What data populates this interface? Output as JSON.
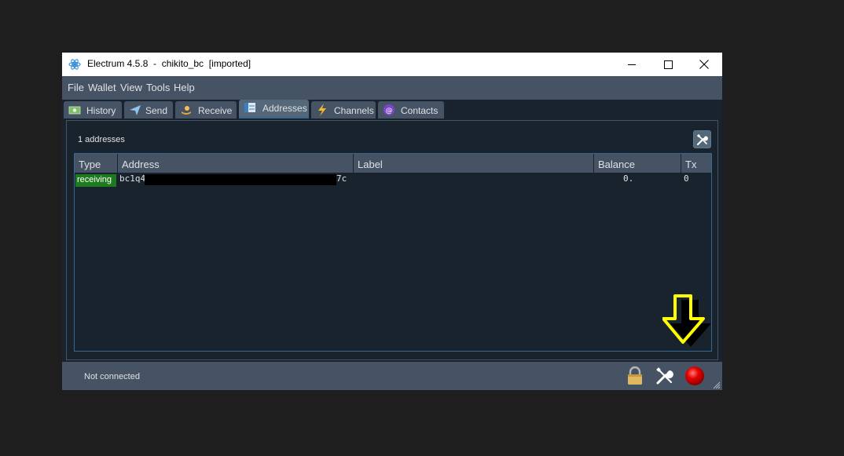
{
  "window": {
    "title": "Electrum 4.5.8  -  chikito_bc  [imported]"
  },
  "menu": [
    "File",
    "Wallet",
    "View",
    "Tools",
    "Help"
  ],
  "tabs": [
    {
      "label": "History",
      "icon": "history-icon"
    },
    {
      "label": "Send",
      "icon": "send-icon"
    },
    {
      "label": "Receive",
      "icon": "receive-icon"
    },
    {
      "label": "Addresses",
      "icon": "addresses-icon",
      "active": true
    },
    {
      "label": "Channels",
      "icon": "lightning-icon"
    },
    {
      "label": "Contacts",
      "icon": "contacts-icon"
    }
  ],
  "addresses": {
    "count_label": "1 addresses",
    "columns": [
      "Type",
      "Address",
      "Label",
      "Balance",
      "Tx"
    ],
    "rows": [
      {
        "type": "receiving",
        "address_start": "bc1q4",
        "address_end": "7c",
        "label": "",
        "balance": "0.",
        "tx": "0"
      }
    ]
  },
  "status": {
    "text": "Not connected"
  },
  "colors": {
    "background": "#19232d",
    "panel": "#455364",
    "accent": "#346792",
    "receiving_badge": "#1e7a1e",
    "annotation_arrow": "#ffff00"
  }
}
